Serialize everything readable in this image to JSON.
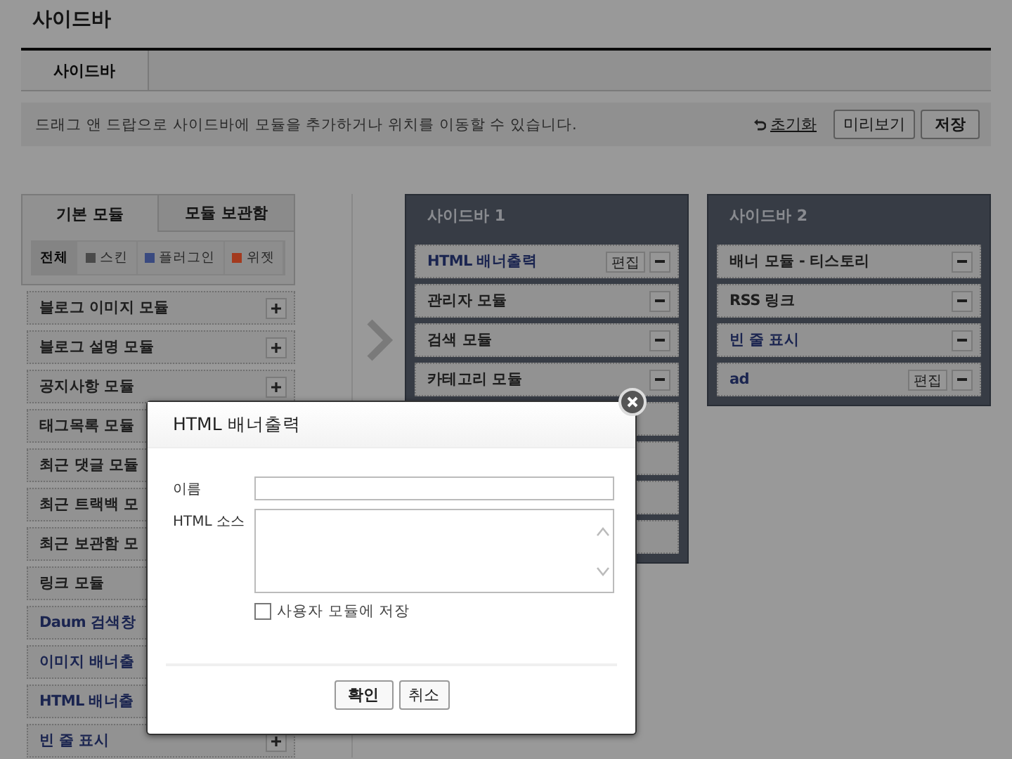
{
  "page_title": "사이드바",
  "tabs": [
    {
      "label": "사이드바",
      "selected": true
    }
  ],
  "notice": "드래그 앤 드랍으로 사이드바에 모듈을 추가하거나 위치를 이동할 수 있습니다.",
  "actions": {
    "reset": "초기화",
    "preview": "미리보기",
    "save": "저장"
  },
  "module_tabs": [
    {
      "label": "기본 모듈",
      "selected": true
    },
    {
      "label": "모듈 보관함",
      "selected": false
    }
  ],
  "filters": [
    {
      "label": "전체",
      "selected": true
    },
    {
      "label": "스킨",
      "selected": false,
      "color": "#4a4a4a"
    },
    {
      "label": "플러그인",
      "selected": false,
      "color": "#3a4a80"
    },
    {
      "label": "위젯",
      "selected": false,
      "color": "#a33a1e"
    }
  ],
  "modules": [
    {
      "label": "블로그 이미지 모듈",
      "kind": "skin",
      "add_button": true
    },
    {
      "label": "블로그 설명 모듈",
      "kind": "skin",
      "add_button": true
    },
    {
      "label": "공지사항 모듈",
      "kind": "skin",
      "add_button": true
    },
    {
      "label": "태그목록 모듈",
      "kind": "skin",
      "add_button": false
    },
    {
      "label": "최근 댓글 모듈",
      "kind": "skin",
      "add_button": false
    },
    {
      "label": "최근 트랙백 모",
      "kind": "skin",
      "add_button": false
    },
    {
      "label": "최근 보관함 모",
      "kind": "skin",
      "add_button": false
    },
    {
      "label": "링크 모듈",
      "kind": "skin",
      "add_button": false
    },
    {
      "label": "Daum 검색창",
      "kind": "plugin",
      "add_button": false
    },
    {
      "label": "이미지 배너출",
      "kind": "plugin",
      "add_button": false
    },
    {
      "label": "HTML 배너출",
      "kind": "plugin",
      "add_button": false
    },
    {
      "label": "빈 줄 표시",
      "kind": "plugin",
      "add_button": true
    }
  ],
  "sidebars": [
    {
      "title": "사이드바 1",
      "items": [
        {
          "label": "HTML 배너출력",
          "kind": "plugin",
          "edit": "편집"
        },
        {
          "label": "관리자 모듈",
          "kind": "skin"
        },
        {
          "label": "검색 모듈",
          "kind": "skin"
        },
        {
          "label": "카테고리 모듈",
          "kind": "skin"
        },
        {
          "kind": "covered"
        },
        {
          "kind": "covered"
        },
        {
          "kind": "covered"
        },
        {
          "kind": "covered"
        }
      ]
    },
    {
      "title": "사이드바 2",
      "items": [
        {
          "label": "배너 모듈 - 티스토리",
          "kind": "skin"
        },
        {
          "label": "RSS 링크",
          "kind": "skin"
        },
        {
          "label": "빈 줄 표시",
          "kind": "plugin"
        },
        {
          "label": "ad",
          "kind": "plugin",
          "edit": "편집"
        }
      ]
    }
  ],
  "dialog": {
    "title": "HTML 배너출력",
    "name_label": "이름",
    "source_label": "HTML 소스",
    "save_checkbox": {
      "label": "사용자 모듈에 저장",
      "checked": false
    },
    "buttons": [
      "확인",
      "취소"
    ]
  }
}
